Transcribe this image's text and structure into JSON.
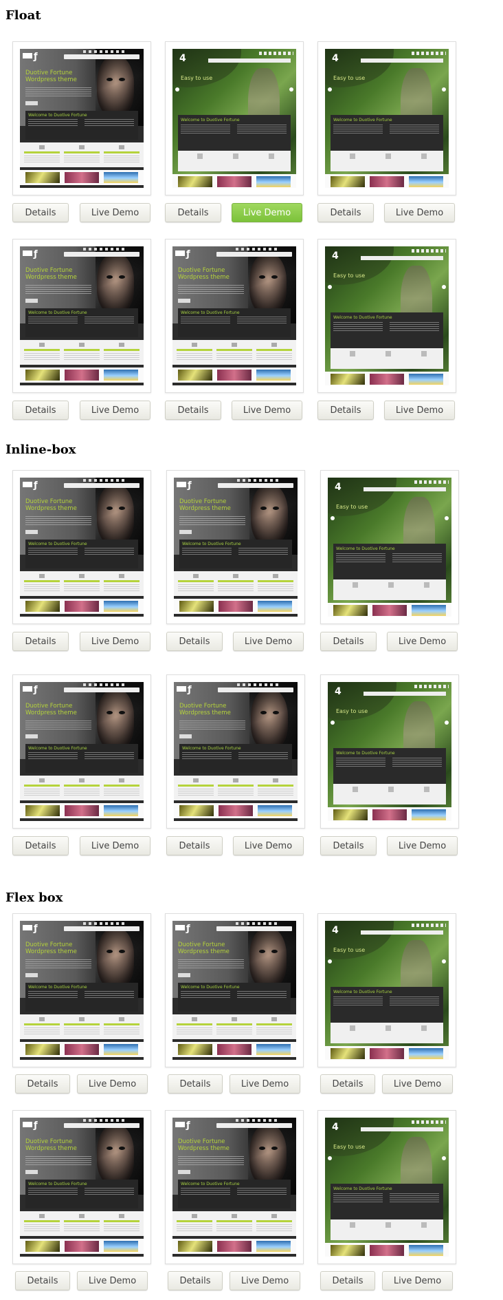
{
  "sections": {
    "float": {
      "heading": "Float"
    },
    "inline": {
      "heading": "Inline-box"
    },
    "flex": {
      "heading": "Flex box"
    }
  },
  "buttons": {
    "details": "Details",
    "live_demo": "Live Demo"
  },
  "preview": {
    "dark_title": "Duotive Fortune  Wordpress theme",
    "welcome": "Welcome to Duotive Fortune",
    "green_title": "Easy to use",
    "logo_glyph": "ƒ",
    "green_logo_glyph": "4"
  },
  "colors": {
    "accent_green": "#8cc63f",
    "heading_text": "#000000",
    "button_text": "#444444"
  }
}
